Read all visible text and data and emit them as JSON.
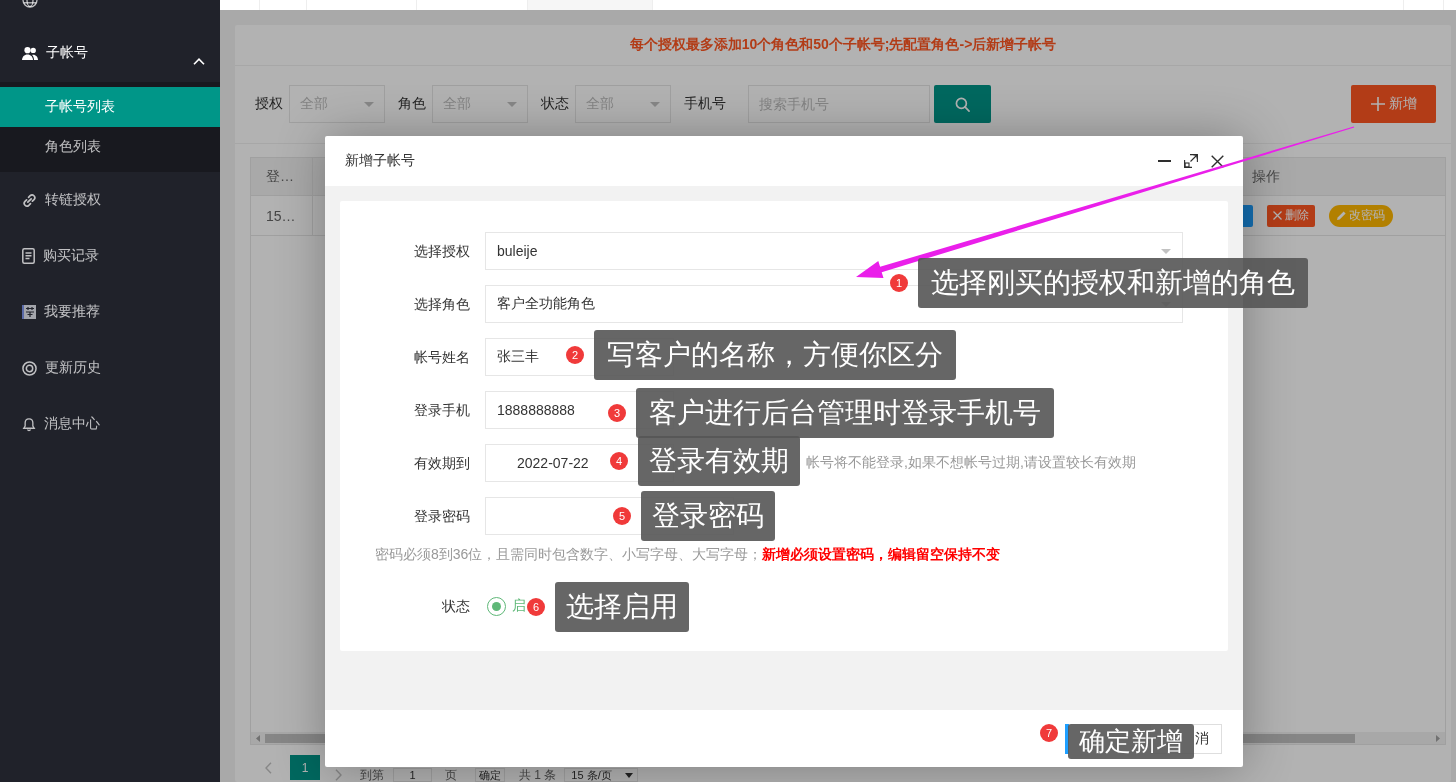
{
  "sidebar": {
    "items": [
      {
        "label": "子帐号",
        "selected": false,
        "expanded": true,
        "children": [
          {
            "label": "子帐号列表",
            "selected": true
          },
          {
            "label": "角色列表",
            "selected": false
          }
        ]
      },
      {
        "label": "转链授权",
        "selected": false
      },
      {
        "label": "购买记录",
        "selected": false
      },
      {
        "label": "我要推荐",
        "selected": false
      },
      {
        "label": "更新历史",
        "selected": false
      },
      {
        "label": "消息中心",
        "selected": false
      }
    ]
  },
  "notice": "每个授权最多添加10个角色和50个子帐号;先配置角色->后新增子帐号",
  "filters": [
    {
      "kind": "select",
      "label": "授权",
      "placeholder": "全部"
    },
    {
      "kind": "select",
      "label": "角色",
      "placeholder": "全部"
    },
    {
      "kind": "select",
      "label": "状态",
      "placeholder": "全部"
    },
    {
      "kind": "search",
      "label": "手机号",
      "placeholder": "搜索手机号"
    }
  ],
  "add_button": "新增",
  "table": {
    "columns": [
      "登…",
      "操作"
    ],
    "rows": [
      {
        "cells": [
          "15…"
        ],
        "actions": [
          {
            "kind": "primary"
          },
          {
            "kind": "danger",
            "label": "删除"
          },
          {
            "kind": "warning",
            "label": "改密码"
          }
        ]
      }
    ]
  },
  "pagination": {
    "pages": [
      {
        "label": "1",
        "selected": true
      }
    ],
    "goto_label": "到第",
    "goto_value": "1",
    "page_unit": "页",
    "confirm": "确定",
    "total": "共 1 条",
    "page_size": "15 条/页"
  },
  "dialog": {
    "title": "新增子帐号",
    "fields": [
      {
        "kind": "select",
        "label": "选择授权",
        "value": "buleije"
      },
      {
        "kind": "select",
        "label": "选择角色",
        "value": "客户全功能角色"
      },
      {
        "kind": "text",
        "label": "帐号姓名",
        "value": "张三丰"
      },
      {
        "kind": "text",
        "label": "登录手机",
        "value": "1888888888"
      },
      {
        "kind": "date",
        "label": "有效期到",
        "value": "2022-07-22",
        "hint": "帐号将不能登录,如果不想帐号过期,请设置较长有效期"
      },
      {
        "kind": "password",
        "label": "登录密码"
      }
    ],
    "password_rule": "密码必须8到36位，且需同时包含数字、小写字母、大写字母；",
    "password_warning": "新增必须设置密码，编辑留空保持不变",
    "status": {
      "label": "状态",
      "options": [
        {
          "label": "启",
          "selected": true
        }
      ]
    },
    "buttons": [
      {
        "kind": "primary"
      },
      {
        "kind": "default",
        "label": "消"
      }
    ]
  },
  "annotations": [
    {
      "number": "1",
      "text": "选择刚买的授权和新增的角色"
    },
    {
      "number": "2",
      "text": "写客户的名称，方便你区分"
    },
    {
      "number": "3",
      "text": "客户进行后台管理时登录手机号"
    },
    {
      "number": "4",
      "text": "登录有效期"
    },
    {
      "number": "5",
      "text": "登录密码"
    },
    {
      "number": "6",
      "text": "选择启用"
    },
    {
      "number": "7",
      "text": "确定新增"
    }
  ]
}
